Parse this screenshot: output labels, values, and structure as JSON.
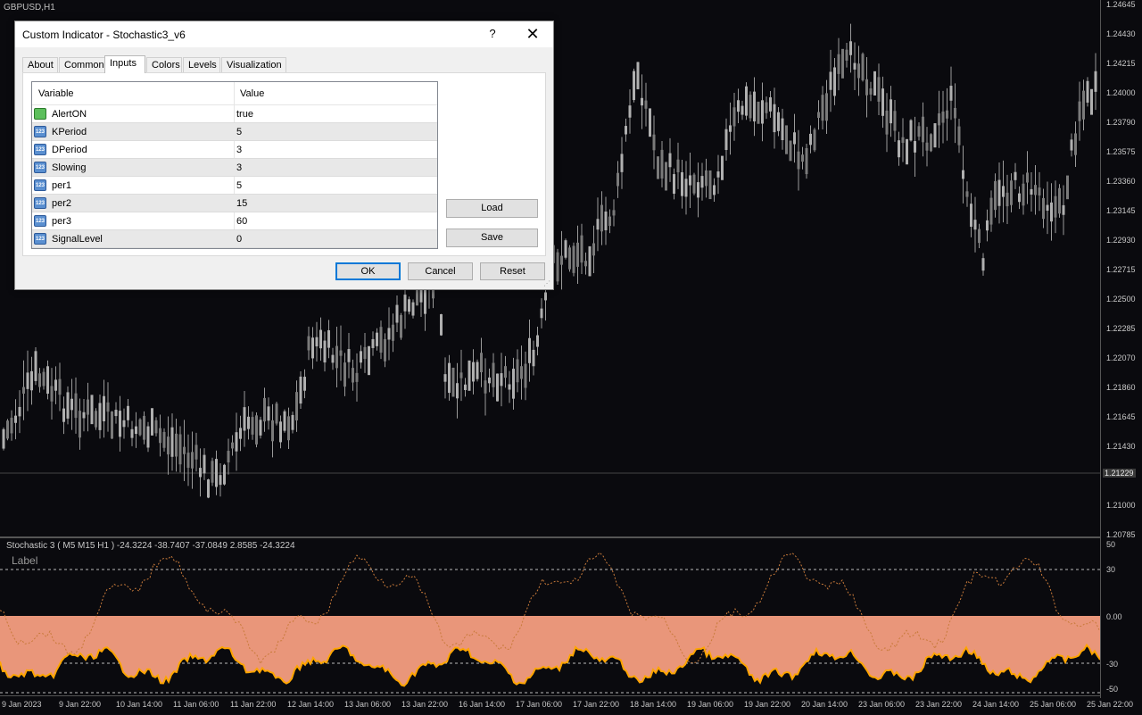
{
  "chart": {
    "symbol": "GBPUSD,H1",
    "price_scale": [
      "1.24645",
      "1.24430",
      "1.24215",
      "1.24000",
      "1.23790",
      "1.23575",
      "1.23360",
      "1.23145",
      "1.22930",
      "1.22715",
      "1.22500",
      "1.22285",
      "1.22070",
      "1.21860",
      "1.21645",
      "1.21430",
      "1.21229",
      "1.21000",
      "1.20785"
    ],
    "current_price": "1.21229",
    "indicator_title": "Stochastic 3 ( M5  M15  H1 ) -24.3224 -38.7407 -37.0849 2.8585 -24.3224",
    "indicator_label": "Label",
    "indicator_scale": [
      "50",
      "30",
      "0.00",
      "-30",
      "-50"
    ],
    "time_axis": [
      "9 Jan 2023",
      "9 Jan 22:00",
      "10 Jan 14:00",
      "11 Jan 06:00",
      "11 Jan 22:00",
      "12 Jan 14:00",
      "13 Jan 06:00",
      "13 Jan 22:00",
      "16 Jan 14:00",
      "17 Jan 06:00",
      "17 Jan 22:00",
      "18 Jan 14:00",
      "19 Jan 06:00",
      "19 Jan 22:00",
      "20 Jan 14:00",
      "23 Jan 06:00",
      "23 Jan 22:00",
      "24 Jan 14:00",
      "25 Jan 06:00",
      "25 Jan 22:00"
    ],
    "colors": {
      "candle": "#9a9a9a",
      "fill": "#e9967a",
      "line": "#ffa500",
      "dots": "#c87a3a"
    }
  },
  "dialog": {
    "title": "Custom Indicator - Stochastic3_v6",
    "help_icon": "?",
    "close_icon": "✕",
    "tabs": [
      "About",
      "Common",
      "Inputs",
      "Colors",
      "Levels",
      "Visualization"
    ],
    "active_tab": "Inputs",
    "columns": {
      "variable": "Variable",
      "value": "Value"
    },
    "rows": [
      {
        "name": "AlertON",
        "value": "true",
        "icon": "bool-icon"
      },
      {
        "name": "KPeriod",
        "value": "5",
        "icon": "number-icon"
      },
      {
        "name": "DPeriod",
        "value": "3",
        "icon": "number-icon"
      },
      {
        "name": "Slowing",
        "value": "3",
        "icon": "number-icon"
      },
      {
        "name": "per1",
        "value": "5",
        "icon": "number-icon"
      },
      {
        "name": "per2",
        "value": "15",
        "icon": "number-icon"
      },
      {
        "name": "per3",
        "value": "60",
        "icon": "number-icon"
      },
      {
        "name": "SignalLevel",
        "value": "0",
        "icon": "number-icon"
      }
    ],
    "buttons": {
      "load": "Load",
      "save": "Save",
      "ok": "OK",
      "cancel": "Cancel",
      "reset": "Reset"
    }
  }
}
